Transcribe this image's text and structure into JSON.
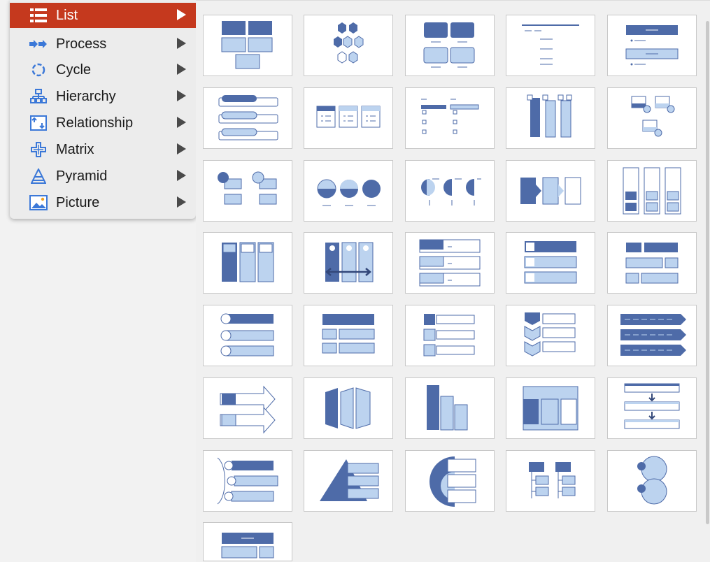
{
  "menu": {
    "items": [
      {
        "label": "List",
        "icon": "list-icon",
        "selected": true
      },
      {
        "label": "Process",
        "icon": "process-icon"
      },
      {
        "label": "Cycle",
        "icon": "cycle-icon"
      },
      {
        "label": "Hierarchy",
        "icon": "hierarchy-icon"
      },
      {
        "label": "Relationship",
        "icon": "relationship-icon"
      },
      {
        "label": "Matrix",
        "icon": "matrix-icon"
      },
      {
        "label": "Pyramid",
        "icon": "pyramid-icon"
      },
      {
        "label": "Picture",
        "icon": "picture-icon"
      }
    ]
  },
  "colors": {
    "selected": "#c5391e",
    "dark_blue": "#4e6ba8",
    "light_blue": "#bcd3ef",
    "outline": "#4e6ba8"
  },
  "gallery": {
    "thumbnail_count": 36,
    "columns": 5
  }
}
